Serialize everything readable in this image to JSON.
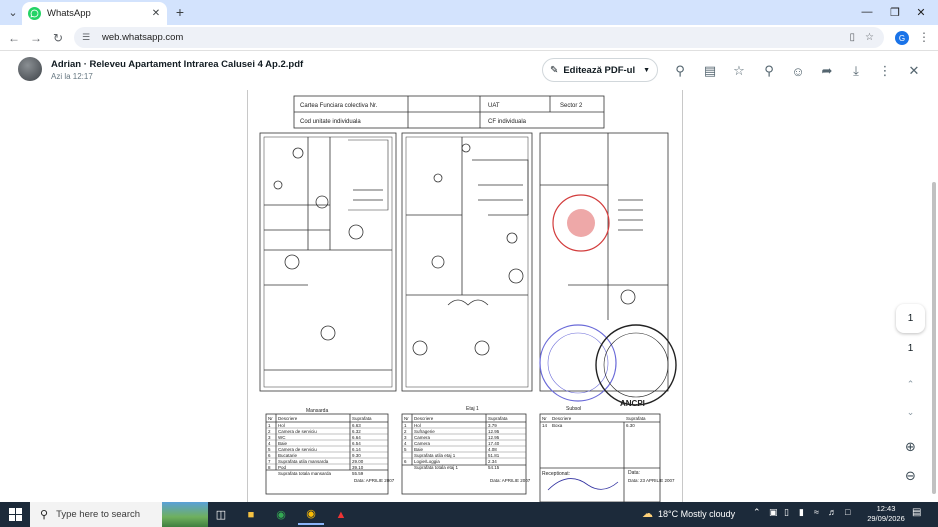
{
  "browser": {
    "tab_title": "WhatsApp",
    "url": "web.whatsapp.com",
    "profile_initial": "G",
    "accent": "#d3e3fd"
  },
  "viewer": {
    "sender": "Adrian · Releveu Apartament Intrarea Calusei 4 Ap.2.pdf",
    "time": "Azi la 12:17",
    "edit_label": "Editează PDF-ul"
  },
  "document": {
    "header_cells": [
      "Cartea Funciara colectiva Nr.",
      "UAT",
      "Sector 2",
      "Cod unitate individuala",
      "CF individuala"
    ],
    "floor_labels": [
      "Mansarda",
      "Etaj 1",
      "Subsol"
    ],
    "stamp_text": "ANCPI",
    "table_mansarda": {
      "headers": [
        "Nr",
        "Descriere",
        "Suprafata"
      ],
      "rows": [
        [
          "1",
          "Hol",
          "6.63"
        ],
        [
          "2",
          "Camera de serviciu",
          "6.32"
        ],
        [
          "3",
          "WC",
          "6.64"
        ],
        [
          "4",
          "Baie",
          "6.54"
        ],
        [
          "5",
          "Camera de serviciu",
          "6.14"
        ],
        [
          "6",
          "Bucatarie",
          "9.30"
        ],
        [
          "7",
          "Suprafata utila mansarda",
          "29.00"
        ],
        [
          "8",
          "Pod",
          "39.10"
        ],
        [
          "",
          "Suprafata totala mansarda",
          "55.59"
        ]
      ],
      "date": "Data: APRILIE 2007"
    },
    "table_etaj": {
      "headers": [
        "Nr",
        "Descriere",
        "Suprafata"
      ],
      "rows": [
        [
          "1",
          "Hol",
          "3.79"
        ],
        [
          "2",
          "Sufragerie",
          "12.95"
        ],
        [
          "3",
          "Camera",
          "12.95"
        ],
        [
          "4",
          "Camera",
          "17.40"
        ],
        [
          "5",
          "Baie",
          "4.08"
        ],
        [
          "",
          "Suprafata utila etaj 1",
          "51.81"
        ],
        [
          "6",
          "Logie/Loggia",
          "2.34"
        ],
        [
          "",
          "Suprafata totala etaj 1",
          "54.15"
        ]
      ],
      "date": "Data: APRILIE 2007"
    },
    "table_subsol": {
      "headers": [
        "Nr",
        "Descriere",
        "Suprafata"
      ],
      "rows": [
        [
          "14",
          "Boxa",
          "6.30"
        ]
      ],
      "date": "Data: 23 APRILIE 2007",
      "receptionat": "Receptionat:",
      "data2": "Data:"
    }
  },
  "pager": {
    "current": "1",
    "total": "1"
  },
  "taskbar": {
    "search_placeholder": "Type here to search",
    "weather": "18°C  Mostly cloudy",
    "time": "12:43",
    "date": "29/09/2026"
  }
}
